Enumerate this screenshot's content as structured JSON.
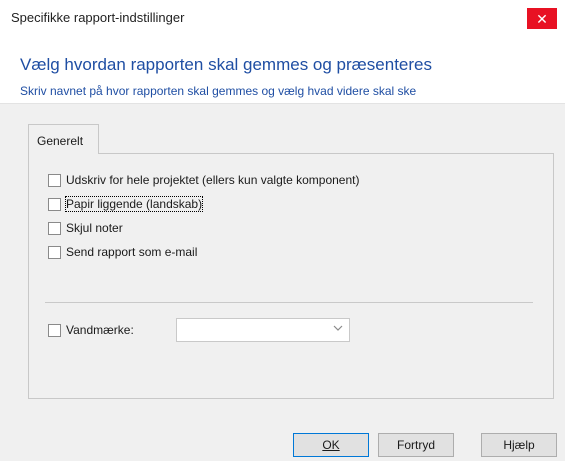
{
  "window": {
    "title": "Specifikke rapport-indstillinger",
    "close_glyph": "✕"
  },
  "header": {
    "title": "Vælg hvordan rapporten skal gemmes og præsenteres",
    "subtitle": "Skriv navnet på hvor rapporten skal gemmes og vælg hvad videre skal ske"
  },
  "tabs": [
    {
      "label": "Generelt",
      "selected": true
    }
  ],
  "options": [
    {
      "label": "Udskriv for hele projektet (ellers kun valgte komponent)",
      "checked": false
    },
    {
      "label": "Papir liggende (landskab)",
      "checked": false,
      "focused": true
    },
    {
      "label": "Skjul noter",
      "checked": false
    },
    {
      "label": "Send rapport som e-mail",
      "checked": false
    }
  ],
  "watermark": {
    "label": "Vandmærke:",
    "checked": false,
    "selected_value": ""
  },
  "buttons": {
    "ok_label": "OK",
    "cancel_label": "Fortryd",
    "help_label": "Hjælp"
  },
  "colors": {
    "accent": "#1f4ea3",
    "close": "#e81123",
    "primary_border": "#0078d7"
  }
}
